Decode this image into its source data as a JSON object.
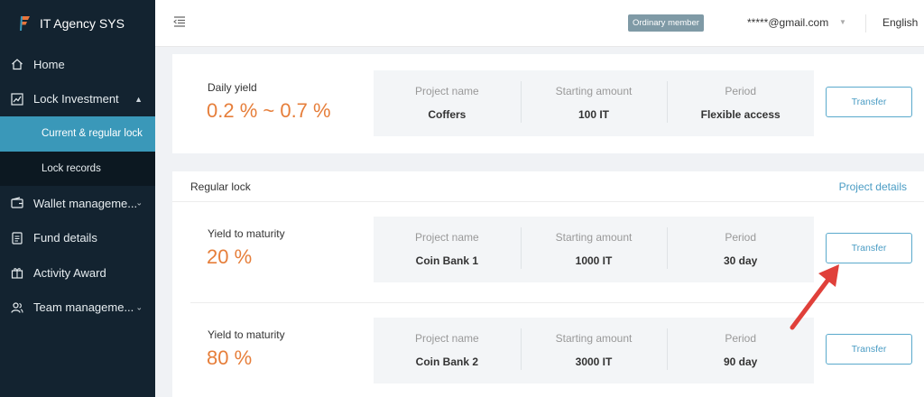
{
  "brand": {
    "name": "IT Agency SYS",
    "color": "#e8743b"
  },
  "sidebar": {
    "items": [
      {
        "label": "Home",
        "icon": "home-icon"
      },
      {
        "label": "Lock Investment",
        "icon": "chart-icon",
        "caret": "▲"
      },
      {
        "label": "Current & regular lock",
        "sub": true,
        "active": true
      },
      {
        "label": "Lock records",
        "sub": true
      },
      {
        "label": "Wallet manageme...",
        "icon": "wallet-icon",
        "caret": "⌄"
      },
      {
        "label": "Fund details",
        "icon": "document-icon"
      },
      {
        "label": "Activity Award",
        "icon": "gift-icon"
      },
      {
        "label": "Team manageme...",
        "icon": "team-icon",
        "caret": "⌄"
      }
    ]
  },
  "header": {
    "badge": "Ordinary member",
    "email": "*****@gmail.com",
    "email_caret": "▼",
    "language": "English"
  },
  "current": {
    "yield_label": "Daily yield",
    "yield_value": "0.2 % ~ 0.7 %",
    "project_head": "Project name",
    "project": "Coffers",
    "amount_head": "Starting amount",
    "amount": "100 IT",
    "period_head": "Period",
    "period": "Flexible access",
    "button": "Transfer"
  },
  "regular": {
    "title": "Regular lock",
    "details_link": "Project details",
    "rows": [
      {
        "yield_label": "Yield to maturity",
        "yield_value": "20 %",
        "project_head": "Project name",
        "project": "Coin Bank 1",
        "amount_head": "Starting amount",
        "amount": "1000 IT",
        "period_head": "Period",
        "period": "30 day",
        "button": "Transfer"
      },
      {
        "yield_label": "Yield to maturity",
        "yield_value": "80 %",
        "project_head": "Project name",
        "project": "Coin Bank 2",
        "amount_head": "Starting amount",
        "amount": "3000 IT",
        "period_head": "Period",
        "period": "90 day",
        "button": "Transfer"
      }
    ]
  },
  "colors": {
    "accent": "#e67e3a",
    "link": "#4a9cc4",
    "sidebar": "#132330",
    "active": "#3a98b9",
    "annotation": "#e0403a"
  }
}
